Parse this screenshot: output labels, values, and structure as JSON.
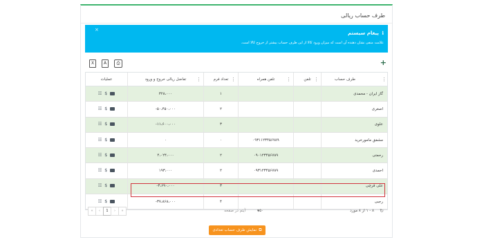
{
  "page": {
    "title": "طرف حساب ریالی"
  },
  "alert": {
    "title": "پیغام سیستم",
    "body": "علامت منفی نشان دهنده آن است که میزان ورود کالا از این طرف حساب بیشتر از خروج کالا است.",
    "close": "×"
  },
  "toolbar": {
    "add": "+",
    "excel": "X",
    "pdf": "A",
    "print": "⎙"
  },
  "table": {
    "headers": {
      "party": "طرف حساب",
      "phone": "تلفن",
      "mobile": "تلفن همراه",
      "count": "تعداد فرم",
      "diff": "تفاضل ریالی خروج و ورود",
      "ops": "عملیات"
    },
    "rows": [
      {
        "party": "گاز ایران - محمدی",
        "phone": "",
        "mobile": "",
        "count": "۱",
        "diff": "۳۲۸،۰۰۰"
      },
      {
        "party": "اصغری",
        "phone": "",
        "mobile": "",
        "count": "۲",
        "diff": "۵۰،۴۵۰،۰۰۰-"
      },
      {
        "party": "علوی",
        "phone": "",
        "mobile": "",
        "count": "۳",
        "diff": "۱۱،۶۰۰،۰۰۰-"
      },
      {
        "party": "مشفق مامورخرید",
        "phone": "",
        "mobile": "۰۹۳۱۱۲۳۴۵۶۷۸۹",
        "count": "۰",
        "diff": "۰"
      },
      {
        "party": "رحمتی",
        "phone": "",
        "mobile": "۰۹۰۱۲۳۴۵۶۷۸۹",
        "count": "۲",
        "diff": "۴،۰۲۴،۰۰۰"
      },
      {
        "party": "احمدی",
        "phone": "",
        "mobile": "۰۹۳۱۲۳۴۵۶۷۸۹",
        "count": "۲",
        "diff": "۱۹۳،۰۰۰"
      },
      {
        "party": "علی قرچی",
        "phone": "",
        "mobile": "",
        "count": "۳",
        "diff": "۳،۶۹۰،۰۰۰-"
      },
      {
        "party": "رجبی",
        "phone": "",
        "mobile": "",
        "count": "۴",
        "diff": "۳۷،۸۶۸،۰۰۰-"
      }
    ]
  },
  "footer": {
    "range": "۸ - ۱ از ۸ مورد",
    "page_size": "۵۰",
    "items_label": "آیتم در صفحه",
    "current_page": "1",
    "first": "«",
    "prev": "‹",
    "next": "›",
    "last": "»"
  },
  "show_button": {
    "label": "نمایش طرف حساب تعدادی",
    "icon": "⧉"
  },
  "colors": {
    "accent_green": "#3eb46e",
    "alert_blue": "#00b8f0",
    "row_green": "#e4f1df",
    "highlight_red": "#d0333d",
    "button_orange": "#f7931e"
  }
}
